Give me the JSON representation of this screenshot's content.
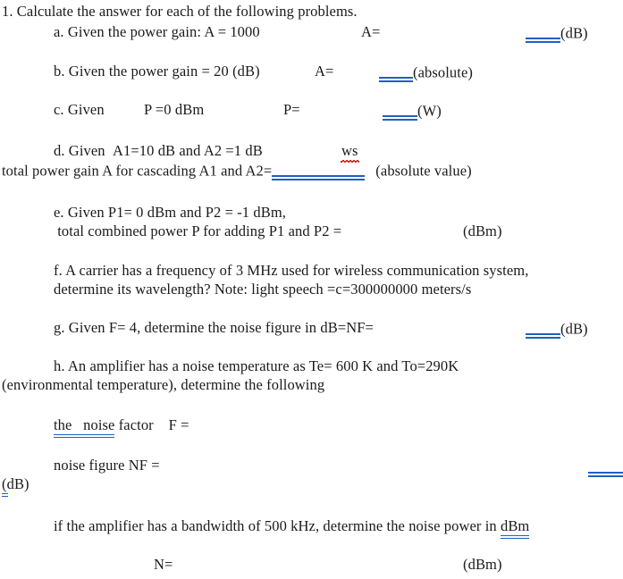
{
  "document": {
    "title": "1. Calculate the answer for each of the following problems.",
    "accent_color": "#2060c0",
    "spellcheck_color": "#e02020",
    "text_color": "#1a1a1a"
  },
  "problems": {
    "heading": "1. Calculate the answer for each of the following problems.",
    "a": {
      "label": "a.",
      "text": "a. Given the power gain: A = 1000",
      "answer_prompt": "A=",
      "unit": "(dB)"
    },
    "b": {
      "label": "b.",
      "text": "b. Given the power gain = 20 (dB)",
      "answer_prompt": "A=",
      "unit": "(absolute)"
    },
    "c": {
      "label": "c.",
      "text": "c. Given",
      "given": "P =0 dBm",
      "answer_prompt": "P=",
      "unit": "(W)"
    },
    "d": {
      "label": "d.",
      "text": "d. Given",
      "given": "A1=10 dB and A2 =1 dB",
      "stray_word": "ws",
      "line2_prefix": "total power gain A for cascading A1 and A2=",
      "unit": "(absolute value)"
    },
    "e": {
      "label": "e.",
      "line1": "e. Given P1= 0 dBm and P2 = -1 dBm,",
      "line2": " total combined power P for adding P1 and P2 =",
      "unit": "(dBm)"
    },
    "f": {
      "label": "f.",
      "line1": "f. A carrier has a frequency of 3 MHz used for wireless communication system,",
      "line2": "determine its wavelength? Note: light speech =c=300000000 meters/s"
    },
    "g": {
      "label": "g.",
      "text": "g. Given F= 4, determine the noise figure in dB=NF=",
      "unit": "(dB)"
    },
    "h": {
      "label": "h.",
      "line1": "h. An amplifier has a noise temperature as Te= 600 K and To=290K",
      "line2": "(environmental temperature), determine the following",
      "sub1": {
        "underlined": "the   noise",
        "rest": " factor    F ="
      },
      "sub2": {
        "text": "noise figure NF =",
        "unit": "(dB)"
      },
      "sub3": {
        "prefix": "if the amplifier has a bandwidth of 500 kHz, determine the noise power in ",
        "underlined": "dBm"
      },
      "sub4": {
        "answer_prompt": "N=",
        "unit": "(dBm)"
      }
    }
  }
}
